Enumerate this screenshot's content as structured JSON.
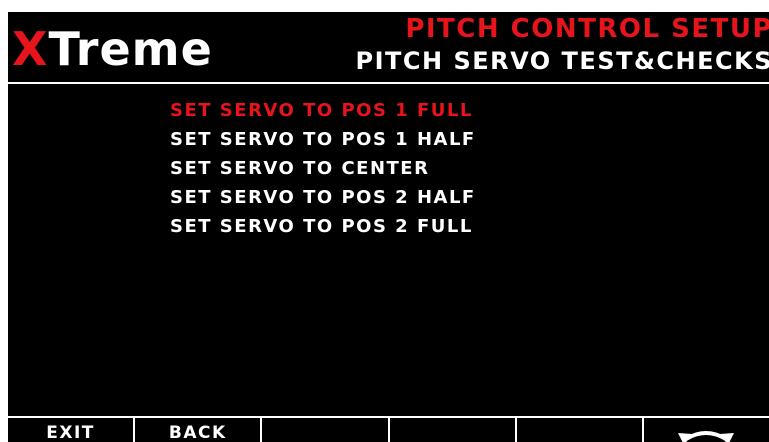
{
  "header": {
    "logo_x": "X",
    "logo_rest": "Treme",
    "title": "PITCH CONTROL SETUP",
    "subtitle": "PITCH SERVO TEST&CHECKS"
  },
  "menu": {
    "selected_index": 0,
    "items": [
      "SET SERVO TO POS 1 FULL",
      "SET SERVO TO POS 1 HALF",
      "SET SERVO TO CENTER",
      "SET SERVO TO POS 2 HALF",
      "SET SERVO TO POS 2 FULL"
    ]
  },
  "softkeys": {
    "key1_label": "EXIT",
    "key2_label": "BACK",
    "key3_label": "",
    "key4_label": "",
    "key5_label": "",
    "key6_icon": "rotary-knob-icon"
  },
  "colors": {
    "background": "#000000",
    "accent": "#e8141c",
    "text": "#ffffff"
  }
}
